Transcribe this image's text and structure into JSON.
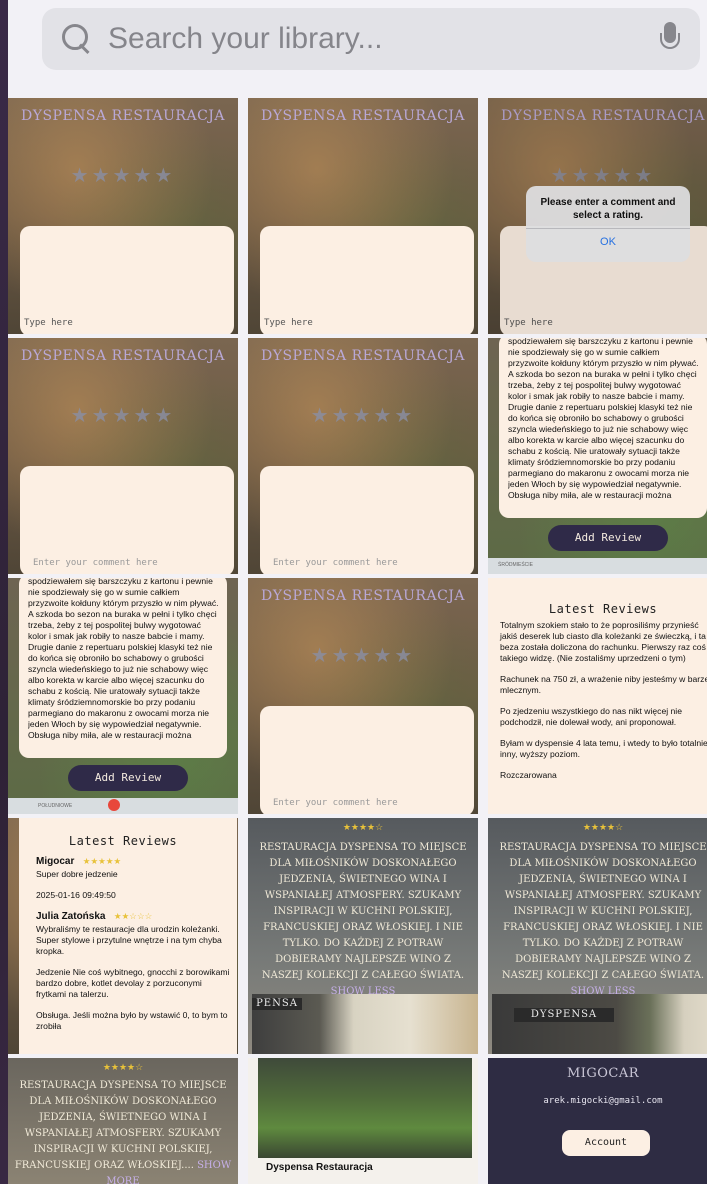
{
  "search": {
    "placeholder": "Search your library..."
  },
  "restaurant": {
    "title": "Dyspensa Restauracja",
    "caption_name": "Dyspensa  Restauracja"
  },
  "cells": {
    "type_here": "Type here",
    "enter_comment": "Enter your comment here",
    "alert": {
      "message": "Please enter a comment and select a rating.",
      "ok": "OK"
    },
    "add_review": "Add Review",
    "review_long_text": "spodziewałem się barszczyku z kartonu i pewnie nie spodziewały się go w sumie całkiem przyzwoite kołduny którym przyszło w nim pływać. A szkoda bo sezon na buraka w pełni i tylko chęci trzeba, żeby z tej pospolitej bulwy wygotować kolor i smak jak robiły to nasze babcie i mamy. Drugie danie z repertuaru polskiej klasyki też nie do końca się obroniło bo schabowy o grubości szyncla wiedeńskiego to już nie schabowy więc albo korekta w karcie albo więcej szacunku do schabu z kością. Nie uratowały sytuacji także klimaty śródziemnomorskie bo przy podaniu parmegiano do makaronu z owocami morza nie jeden Włoch by się wypowiedział negatywnie. Obsługa niby miła, ale w restauracji można wymagać ciut więcej i",
    "map_label_1": "ŚRÓDMIEŚCIE",
    "map_label_2": "POŁUDNIOWE",
    "latest_reviews_title": "Latest Reviews",
    "latest_review_text_1": "Totalnym szokiem stało to że poprosiliśmy przynieść jakiś deserek lub ciasto dla koleżanki ze świeczką, i ta beza została doliczona do rachunku. Pierwszy raz coś takiego widzę. (Nie zostaliśmy uprzedzeni o tym)",
    "latest_review_text_2": "Rachunek na 750 zł, a wrażenie niby jesteśmy w barze mlecznym.",
    "latest_review_text_3": "Po zjedzeniu wszystkiego do nas nikt więcej nie podchodził, nie dolewał wody, ani proponował.",
    "latest_review_text_4": "Byłam w dyspensie 4 lata temu, i wtedy to było totalnie inny, wyższy poziom.",
    "latest_review_text_5": "Rozczarowana",
    "reviewer1_name": "Migocar",
    "reviewer1_stars": "★★★★★",
    "reviewer1_text": "Super dobre jedzenie",
    "reviewer1_date": "2025-01-16 09:49:50",
    "reviewer2_name": "Julia Zatońska",
    "reviewer2_stars": "★★☆☆☆",
    "reviewer2_text": "Wybraliśmy te restauracje dla urodzin koleżanki. Super stylowe i przytulne wnętrze i na tym chyba kropka.",
    "reviewer2_text2": "Jedzenie Nie coś wybitnego, gnocchi z borowikami bardzo dobre, kotlet devolay z porzuconymi frytkami na talerzu.",
    "reviewer2_text3": "Obsługa. Jeśli można było by wstawić 0, to bym to zrobiła",
    "desc_stars": "★★★★☆",
    "description": "Restauracja Dyspensa to miejsce dla miłośników doskonałego jedzenia, świetnego wina i wspaniałej atmosfery. Szukamy inspiracji w kuchni polskiej, francuskiej oraz włoskiej. I nie tylko. Do każdej z potraw dobieramy najlepsze wino z naszej kolekcji z całego świata.",
    "description_short": "Restauracja Dyspensa to miejsce dla miłośników doskonałego jedzenia, świetnego wina i wspaniałej atmosfery. Szukamy inspiracji w kuchni polskiej, francuskiej oraz włoskiej....",
    "show_less": "Show Less",
    "show_more": "Show More",
    "sign_text": "DYSPENSA",
    "sign_text_small": "PENSA",
    "profile_name": "Migocar",
    "profile_email": "arek.migocki@gmail.com",
    "account_button": "Account"
  },
  "colors": {
    "accent": "#2f2a48",
    "card": "#fcefe3",
    "star": "#e8c23a"
  }
}
